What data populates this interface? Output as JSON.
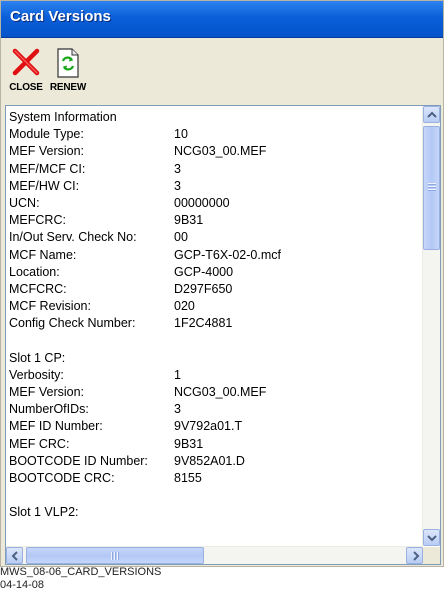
{
  "window": {
    "title": "Card Versions"
  },
  "toolbar": {
    "close_label": "CLOSE",
    "renew_label": "RENEW"
  },
  "system_info": {
    "heading": "System Information",
    "rows": [
      {
        "label": "Module Type:",
        "value": "10"
      },
      {
        "label": "MEF Version:",
        "value": "NCG03_00.MEF"
      },
      {
        "label": "MEF/MCF CI:",
        "value": "3"
      },
      {
        "label": "MEF/HW CI:",
        "value": "3"
      },
      {
        "label": "UCN:",
        "value": "00000000"
      },
      {
        "label": "MEFCRC:",
        "value": "9B31"
      },
      {
        "label": "In/Out Serv. Check No:",
        "value": "00"
      },
      {
        "label": "MCF Name:",
        "value": "GCP-T6X-02-0.mcf"
      },
      {
        "label": "Location:",
        "value": "GCP-4000"
      },
      {
        "label": "MCFCRC:",
        "value": "D297F650"
      },
      {
        "label": "MCF Revision:",
        "value": "020"
      },
      {
        "label": "Config Check Number:",
        "value": "1F2C4881"
      }
    ]
  },
  "slot1_cp": {
    "heading": "Slot 1 CP:",
    "rows": [
      {
        "label": "Verbosity:",
        "value": "1"
      },
      {
        "label": "MEF Version:",
        "value": "NCG03_00.MEF"
      },
      {
        "label": "NumberOfIDs:",
        "value": "3"
      },
      {
        "label": "MEF ID Number:",
        "value": "9V792a01.T"
      },
      {
        "label": "MEF CRC:",
        "value": "9B31"
      },
      {
        "label": "BOOTCODE ID Number:",
        "value": "9V852A01.D"
      },
      {
        "label": "BOOTCODE CRC:",
        "value": "8155"
      }
    ]
  },
  "slot1_vlp2": {
    "heading": "Slot 1 VLP2:"
  },
  "caption": {
    "line1": "MWS_08-06_CARD_VERSIONS",
    "line2": "04-14-08"
  },
  "icons": {
    "close": "red-x-icon",
    "renew": "document-refresh-icon"
  },
  "colors": {
    "titlebar": "#0a5fd9",
    "close_x": "#e01010",
    "renew_arrows": "#1aa81a"
  }
}
